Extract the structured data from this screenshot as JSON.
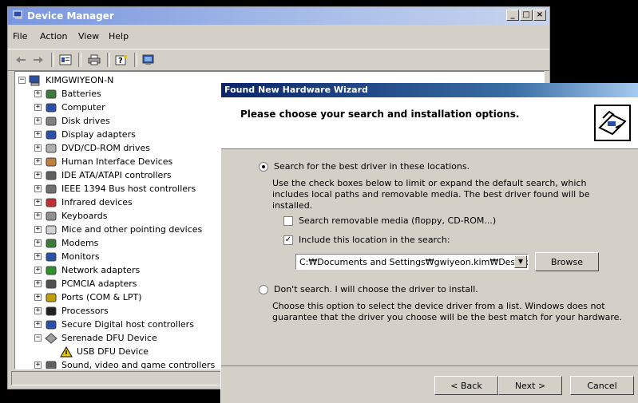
{
  "device_manager": {
    "title": "Device Manager",
    "menu": [
      "File",
      "Action",
      "View",
      "Help"
    ],
    "caption_buttons": [
      "_",
      "□",
      "×"
    ],
    "tree": {
      "root": "KIMGWIYEON-N",
      "items": [
        {
          "label": "Batteries",
          "icon": "battery-icon",
          "expander": "+"
        },
        {
          "label": "Computer",
          "icon": "computer-icon",
          "expander": "+"
        },
        {
          "label": "Disk drives",
          "icon": "disk-drive-icon",
          "expander": "+"
        },
        {
          "label": "Display adapters",
          "icon": "monitor-icon",
          "expander": "+"
        },
        {
          "label": "DVD/CD-ROM drives",
          "icon": "cdrom-icon",
          "expander": "+"
        },
        {
          "label": "Human Interface Devices",
          "icon": "hid-icon",
          "expander": "+"
        },
        {
          "label": "IDE ATA/ATAPI controllers",
          "icon": "ide-icon",
          "expander": "+"
        },
        {
          "label": "IEEE 1394 Bus host controllers",
          "icon": "ieee1394-icon",
          "expander": "+"
        },
        {
          "label": "Infrared devices",
          "icon": "infrared-icon",
          "expander": "+"
        },
        {
          "label": "Keyboards",
          "icon": "keyboard-icon",
          "expander": "+"
        },
        {
          "label": "Mice and other pointing devices",
          "icon": "mouse-icon",
          "expander": "+"
        },
        {
          "label": "Modems",
          "icon": "modem-icon",
          "expander": "+"
        },
        {
          "label": "Monitors",
          "icon": "monitor-icon",
          "expander": "+"
        },
        {
          "label": "Network adapters",
          "icon": "network-icon",
          "expander": "+"
        },
        {
          "label": "PCMCIA adapters",
          "icon": "pcmcia-icon",
          "expander": "+"
        },
        {
          "label": "Ports (COM & LPT)",
          "icon": "port-icon",
          "expander": "+"
        },
        {
          "label": "Processors",
          "icon": "processor-icon",
          "expander": "+"
        },
        {
          "label": "Secure Digital host controllers",
          "icon": "sd-icon",
          "expander": "+"
        },
        {
          "label": "Serenade DFU Device",
          "icon": "diamond-icon",
          "expander": "−"
        },
        {
          "label": "USB DFU Device",
          "icon": "warning-icon",
          "expander": ""
        },
        {
          "label": "Sound, video and game controllers",
          "icon": "sound-icon",
          "expander": "+"
        }
      ]
    }
  },
  "wizard": {
    "title": "Found New Hardware Wizard",
    "header_title": "Please choose your search and installation options.",
    "option_search": {
      "label": "Search for the best driver in these locations.",
      "description": "Use the check boxes below to limit or expand the default search, which includes local paths and removable media. The best driver found will be installed.",
      "selected": true
    },
    "check_removable": {
      "label": "Search removable media (floppy, CD-ROM...)",
      "checked": false
    },
    "check_location": {
      "label": "Include this location in the search:",
      "checked": true
    },
    "location_value": "C:₩Documents and Settings₩gwiyeon.kim₩Deskto",
    "browse_label": "Browse",
    "option_dont_search": {
      "label": "Don't search. I will choose the driver to install.",
      "description": "Choose this option to select the device driver from a list.  Windows does not guarantee that the driver you choose will be the best match for your hardware.",
      "selected": false
    },
    "buttons": {
      "back": "< Back",
      "next": "Next >",
      "cancel": "Cancel"
    }
  }
}
